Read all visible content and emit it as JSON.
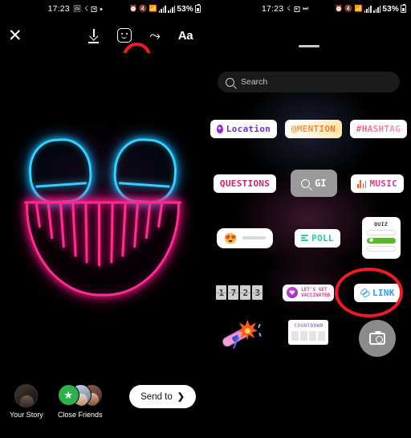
{
  "left_panel": {
    "status_bar": {
      "time": "17:23",
      "icons": [
        "image-icon",
        "bluetooth-icon",
        "sim-icon",
        "dot-icon"
      ],
      "right_icons": [
        "alarm-icon",
        "mute-icon",
        "wifi-icon",
        "signal-icon",
        "signal-icon"
      ],
      "battery_percent": "53%"
    },
    "toolbar": {
      "close_label": "✕",
      "download_name": "download-icon",
      "sticker_name": "sticker-icon",
      "draw_label": "⤳",
      "text_label": "Aa",
      "highlighted": "sticker-icon"
    },
    "photo": {
      "description": "neon LED purge mask with cyan eyes and pink teeth"
    },
    "share_bar": {
      "audiences": [
        {
          "label": "Your Story",
          "avatar": "user-avatar"
        },
        {
          "label": "Close Friends",
          "avatar": "close-friends-avatars"
        }
      ],
      "send_button": {
        "label": "Send to",
        "chevron": "❯"
      }
    }
  },
  "right_panel": {
    "status_bar": {
      "time": "17:23",
      "icons": [
        "bluetooth-icon",
        "sim-icon",
        "dnd-icon"
      ],
      "battery_percent": "53%"
    },
    "search": {
      "placeholder": "Search",
      "icon": "search-icon"
    },
    "sticker_rows": [
      [
        {
          "name": "location-sticker",
          "label": "Location",
          "icon": "pin-icon"
        },
        {
          "name": "mention-sticker",
          "label": "@MENTION"
        },
        {
          "name": "hashtag-sticker",
          "label": "#HASHTAG"
        }
      ],
      [
        {
          "name": "questions-sticker",
          "label": "QUESTIONS"
        },
        {
          "name": "gif-sticker",
          "label": "GI",
          "icon": "search-icon"
        },
        {
          "name": "music-sticker",
          "label": "MUSIC",
          "icon": "equalizer-icon"
        }
      ],
      [
        {
          "name": "emoji-slider-sticker",
          "emoji": "😍"
        },
        {
          "name": "poll-sticker",
          "label": "POLL"
        },
        {
          "name": "quiz-sticker",
          "label": "QUIZ"
        }
      ],
      [
        {
          "name": "time-sticker",
          "digits": [
            "1",
            "7",
            "2",
            "3"
          ]
        },
        {
          "name": "vaccinated-sticker",
          "line1": "LET'S GET",
          "line2": "VACCINATED"
        },
        {
          "name": "link-sticker",
          "label": "LINK",
          "icon": "link-icon"
        }
      ],
      [
        {
          "name": "flower-bandaid-sticker"
        },
        {
          "name": "countdown-sticker",
          "label": "COUNTDOWN"
        },
        {
          "name": "camera-sticker",
          "icon": "camera-icon"
        }
      ]
    ],
    "highlighted": "link-sticker"
  },
  "colors": {
    "highlight_ring": "#ee1c22",
    "accent_link": "#2d9bf0",
    "accent_poll": "#2ec7b0",
    "accent_questions": "#d81f6a",
    "background": "#000000"
  }
}
